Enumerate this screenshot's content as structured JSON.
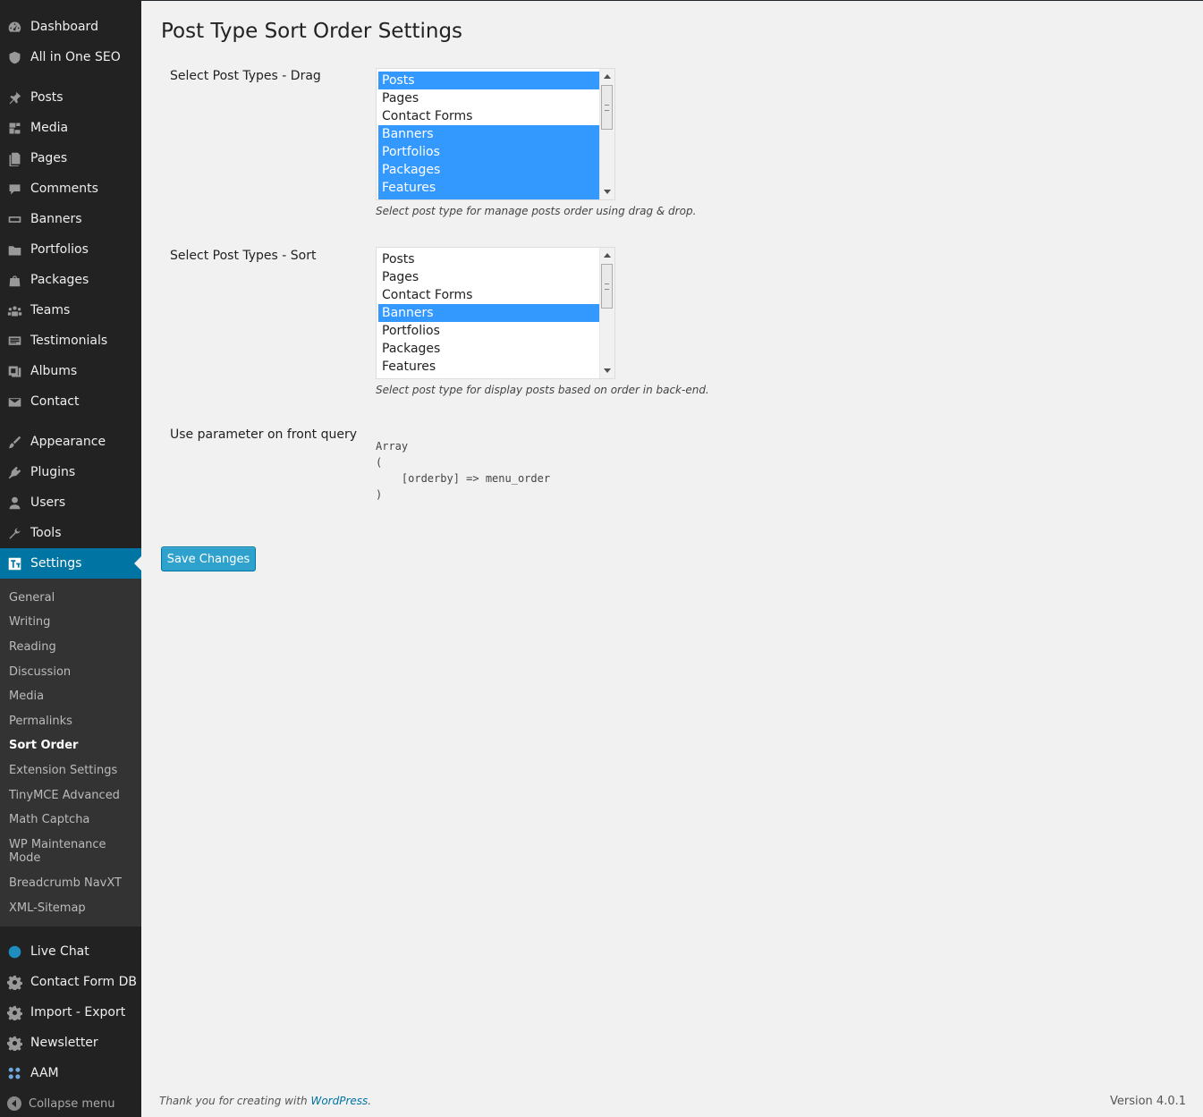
{
  "colors": {
    "sidebar_bg": "#222222",
    "submenu_bg": "#333333",
    "accent": "#0074a2",
    "selection": "#3399ff",
    "button": "#2ea2cc"
  },
  "sidebar": {
    "top_items": [
      {
        "label": "Dashboard",
        "icon": "dashboard-icon"
      },
      {
        "label": "All in One SEO",
        "icon": "shield-icon"
      }
    ],
    "items": [
      {
        "label": "Posts",
        "icon": "pin-icon"
      },
      {
        "label": "Media",
        "icon": "media-icon"
      },
      {
        "label": "Pages",
        "icon": "page-icon"
      },
      {
        "label": "Comments",
        "icon": "comment-icon"
      },
      {
        "label": "Banners",
        "icon": "banner-icon"
      },
      {
        "label": "Portfolios",
        "icon": "folder-icon"
      },
      {
        "label": "Packages",
        "icon": "bag-icon"
      },
      {
        "label": "Teams",
        "icon": "group-icon"
      },
      {
        "label": "Testimonials",
        "icon": "testimonial-icon"
      },
      {
        "label": "Albums",
        "icon": "album-icon"
      },
      {
        "label": "Contact",
        "icon": "mail-icon"
      }
    ],
    "admin_items": [
      {
        "label": "Appearance",
        "icon": "brush-icon"
      },
      {
        "label": "Plugins",
        "icon": "plugin-icon"
      },
      {
        "label": "Users",
        "icon": "user-icon"
      },
      {
        "label": "Tools",
        "icon": "wrench-icon"
      }
    ],
    "current": {
      "label": "Settings",
      "icon": "settings-icon"
    },
    "submenu": [
      "General",
      "Writing",
      "Reading",
      "Discussion",
      "Media",
      "Permalinks",
      "Sort Order",
      "Extension Settings",
      "TinyMCE Advanced",
      "Math Captcha",
      "WP Maintenance Mode",
      "Breadcrumb NavXT",
      "XML-Sitemap"
    ],
    "submenu_active": "Sort Order",
    "plugin_items": [
      {
        "label": "Live Chat",
        "icon": "globe-icon"
      },
      {
        "label": "Contact Form DB",
        "icon": "gear-icon"
      },
      {
        "label": "Import - Export",
        "icon": "gear-icon"
      },
      {
        "label": "Newsletter",
        "icon": "gear-icon"
      },
      {
        "label": "AAM",
        "icon": "aam-icon"
      }
    ],
    "collapse_label": "Collapse menu"
  },
  "main": {
    "title": "Post Type Sort Order Settings",
    "drag": {
      "label": "Select Post Types - Drag",
      "options": [
        {
          "label": "Posts",
          "selected": true
        },
        {
          "label": "Pages",
          "selected": false
        },
        {
          "label": "Contact Forms",
          "selected": false
        },
        {
          "label": "Banners",
          "selected": true
        },
        {
          "label": "Portfolios",
          "selected": true
        },
        {
          "label": "Packages",
          "selected": true
        },
        {
          "label": "Features",
          "selected": true
        }
      ],
      "description": "Select post type for manage posts order using drag & drop."
    },
    "sort": {
      "label": "Select Post Types - Sort",
      "options": [
        {
          "label": "Posts",
          "selected": false
        },
        {
          "label": "Pages",
          "selected": false
        },
        {
          "label": "Contact Forms",
          "selected": false
        },
        {
          "label": "Banners",
          "selected": true
        },
        {
          "label": "Portfolios",
          "selected": false
        },
        {
          "label": "Packages",
          "selected": false
        },
        {
          "label": "Features",
          "selected": false
        }
      ],
      "description": "Select post type for display posts based on order in back-end."
    },
    "query": {
      "label": "Use parameter on front query",
      "code": "Array\n(\n    [orderby] => menu_order\n)"
    },
    "save_label": "Save Changes"
  },
  "footer": {
    "thanks_text": "Thank you for creating with ",
    "thanks_link": "WordPress",
    "thanks_end": ".",
    "version": "Version 4.0.1"
  }
}
